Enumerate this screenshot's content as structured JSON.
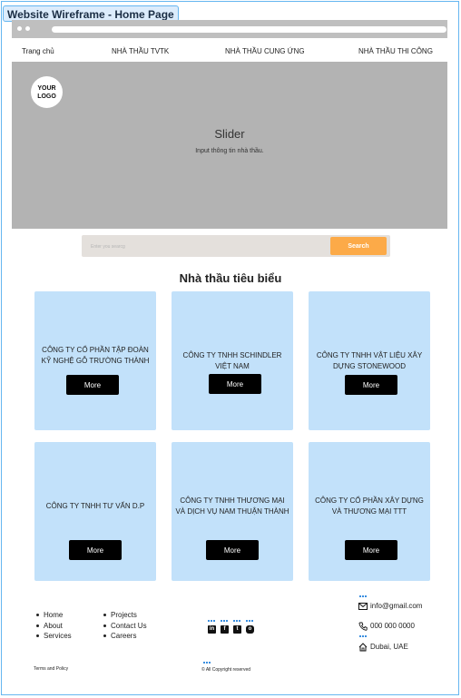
{
  "frame": {
    "title": "Website Wireframe - Home Page"
  },
  "nav": {
    "items": [
      "Trang chủ",
      "NHÀ THẦU TVTK",
      "NHÀ THẦU CUNG ỨNG",
      "NHÀ THẦU THI CÔNG"
    ]
  },
  "hero": {
    "logo_line1": "YOUR",
    "logo_line2": "LOGO",
    "title": "Slider",
    "subtitle": "Input thông tin nhà thầu."
  },
  "search": {
    "placeholder": "Enter you searcg",
    "button_label": "Search"
  },
  "section": {
    "title": "Nhà thầu tiêu biểu",
    "cards": [
      {
        "name": "CÔNG TY CỔ PHẦN TẬP ĐOÀN KỸ NGHỆ GỖ TRƯỜNG THÀNH",
        "button": "More"
      },
      {
        "name": "CÔNG TY TNHH SCHINDLER VIỆT NAM",
        "button": "More"
      },
      {
        "name": "CÔNG TY TNHH VẬT LIỆU XÂY DỰNG STONEWOOD",
        "button": "More"
      },
      {
        "name": "CÔNG TY TNHH TƯ VẤN D.P",
        "button": "More"
      },
      {
        "name": "CÔNG TY TNHH THƯƠNG MẠI VÀ DỊCH VỤ NAM THUẬN THÀNH",
        "button": "More"
      },
      {
        "name": "CÔNG TY CỔ PHẦN XÂY DỰNG VÀ THƯƠNG MẠI TTT",
        "button": "More"
      }
    ]
  },
  "footer": {
    "links_col1": [
      "Home",
      "About",
      "Services"
    ],
    "links_col2": [
      "Projects",
      "Contact Us",
      "Careers"
    ],
    "social_icons": [
      "linkedin-icon",
      "facebook-icon",
      "twitter-icon",
      "instagram-icon"
    ],
    "email": "info@gmail.com",
    "phone": "000 000 0000",
    "address": "Dubai, UAE",
    "terms": "Terms and Policy",
    "copyright": "All Copyright reserved"
  },
  "colors": {
    "frame_border": "#66b6f0",
    "hero_bg": "#b3b3b3",
    "card_bg": "#c2e1fa",
    "search_button": "#fcaa48",
    "card_button": "#000000"
  }
}
